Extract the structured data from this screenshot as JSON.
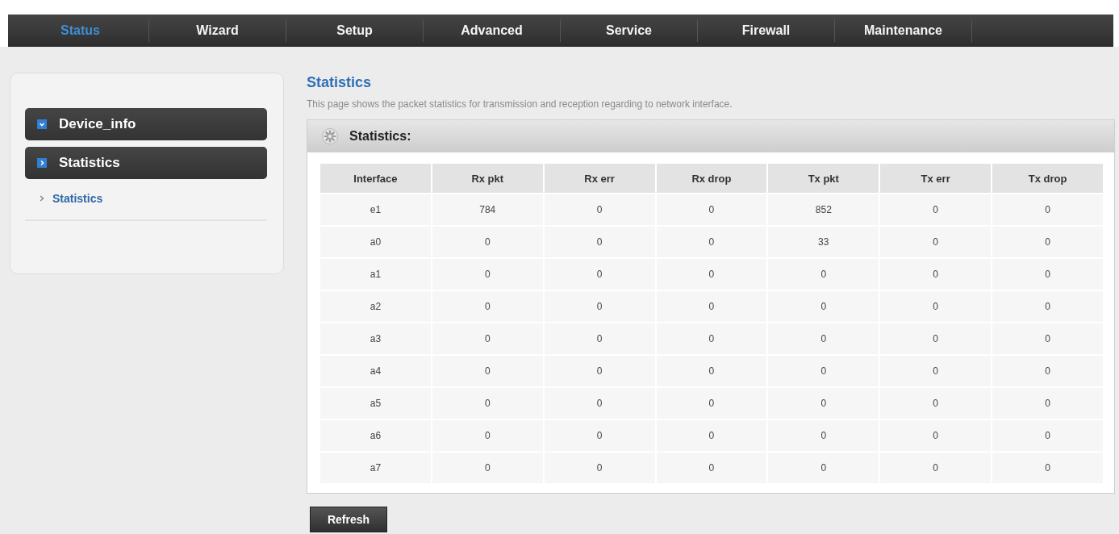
{
  "nav": {
    "tabs": [
      {
        "label": "Status",
        "selected": true
      },
      {
        "label": "Wizard",
        "selected": false
      },
      {
        "label": "Setup",
        "selected": false
      },
      {
        "label": "Advanced",
        "selected": false
      },
      {
        "label": "Service",
        "selected": false
      },
      {
        "label": "Firewall",
        "selected": false
      },
      {
        "label": "Maintenance",
        "selected": false
      }
    ]
  },
  "sidebar": {
    "groups": [
      {
        "label": "Device_info",
        "selected": false
      },
      {
        "label": "Statistics",
        "selected": true,
        "children": [
          {
            "label": "Statistics"
          }
        ]
      }
    ]
  },
  "page": {
    "title": "Statistics",
    "description": "This page shows the packet statistics for transmission and reception regarding to network interface."
  },
  "panel": {
    "title": "Statistics:",
    "table": {
      "columns": [
        "Interface",
        "Rx pkt",
        "Rx err",
        "Rx drop",
        "Tx pkt",
        "Tx err",
        "Tx drop"
      ],
      "rows": [
        [
          "e1",
          "784",
          "0",
          "0",
          "852",
          "0",
          "0"
        ],
        [
          "a0",
          "0",
          "0",
          "0",
          "33",
          "0",
          "0"
        ],
        [
          "a1",
          "0",
          "0",
          "0",
          "0",
          "0",
          "0"
        ],
        [
          "a2",
          "0",
          "0",
          "0",
          "0",
          "0",
          "0"
        ],
        [
          "a3",
          "0",
          "0",
          "0",
          "0",
          "0",
          "0"
        ],
        [
          "a4",
          "0",
          "0",
          "0",
          "0",
          "0",
          "0"
        ],
        [
          "a5",
          "0",
          "0",
          "0",
          "0",
          "0",
          "0"
        ],
        [
          "a6",
          "0",
          "0",
          "0",
          "0",
          "0",
          "0"
        ],
        [
          "a7",
          "0",
          "0",
          "0",
          "0",
          "0",
          "0"
        ]
      ]
    }
  },
  "buttons": [
    {
      "label": "Refresh"
    }
  ]
}
